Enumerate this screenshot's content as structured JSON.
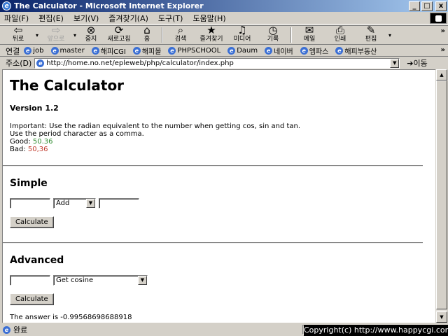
{
  "window": {
    "title": "The Calculator - Microsoft Internet Explorer",
    "buttons": {
      "minimize": "_",
      "maximize": "□",
      "close": "x"
    }
  },
  "menu": [
    "파일(F)",
    "편집(E)",
    "보기(V)",
    "즐겨찾기(A)",
    "도구(T)",
    "도움말(H)"
  ],
  "toolbar": {
    "back": "뒤로",
    "forward": "앞으로",
    "stop": "중지",
    "refresh": "새로고침",
    "home": "홈",
    "search": "검색",
    "favorites": "즐겨찾기",
    "media": "미디어",
    "history": "기록",
    "mail": "메일",
    "print": "인쇄",
    "edit": "편집",
    "more": "»"
  },
  "links": {
    "label": "연결",
    "items": [
      "job",
      "master",
      "해피CGI",
      "해피몰",
      "PHPSCHOOL",
      "Daum",
      "네이버",
      "엠파스",
      "해피부동산"
    ],
    "more": "»"
  },
  "address": {
    "label": "주소(D)",
    "url": "http://home.no.net/epleweb/php/calculator/index.php",
    "go": "이동"
  },
  "page": {
    "title": "The Calculator",
    "version": "Version 1.2",
    "important": "Important: Use the radian equivalent to the number when getting cos, sin and tan.",
    "period_note": "Use the period character as a comma.",
    "good_label": "Good:",
    "good_value": "50.36",
    "bad_label": "Bad:",
    "bad_value": "50,36",
    "simple": {
      "heading": "Simple",
      "operand1": "",
      "operation": "Add",
      "operand2": "",
      "button": "Calculate"
    },
    "advanced": {
      "heading": "Advanced",
      "operand": "",
      "operation": "Get cosine",
      "button": "Calculate"
    },
    "answer": "The answer is -0.99568698688918"
  },
  "status": {
    "text": "완료",
    "copyright": "Copyright(c) http://www.happycgi.com"
  }
}
